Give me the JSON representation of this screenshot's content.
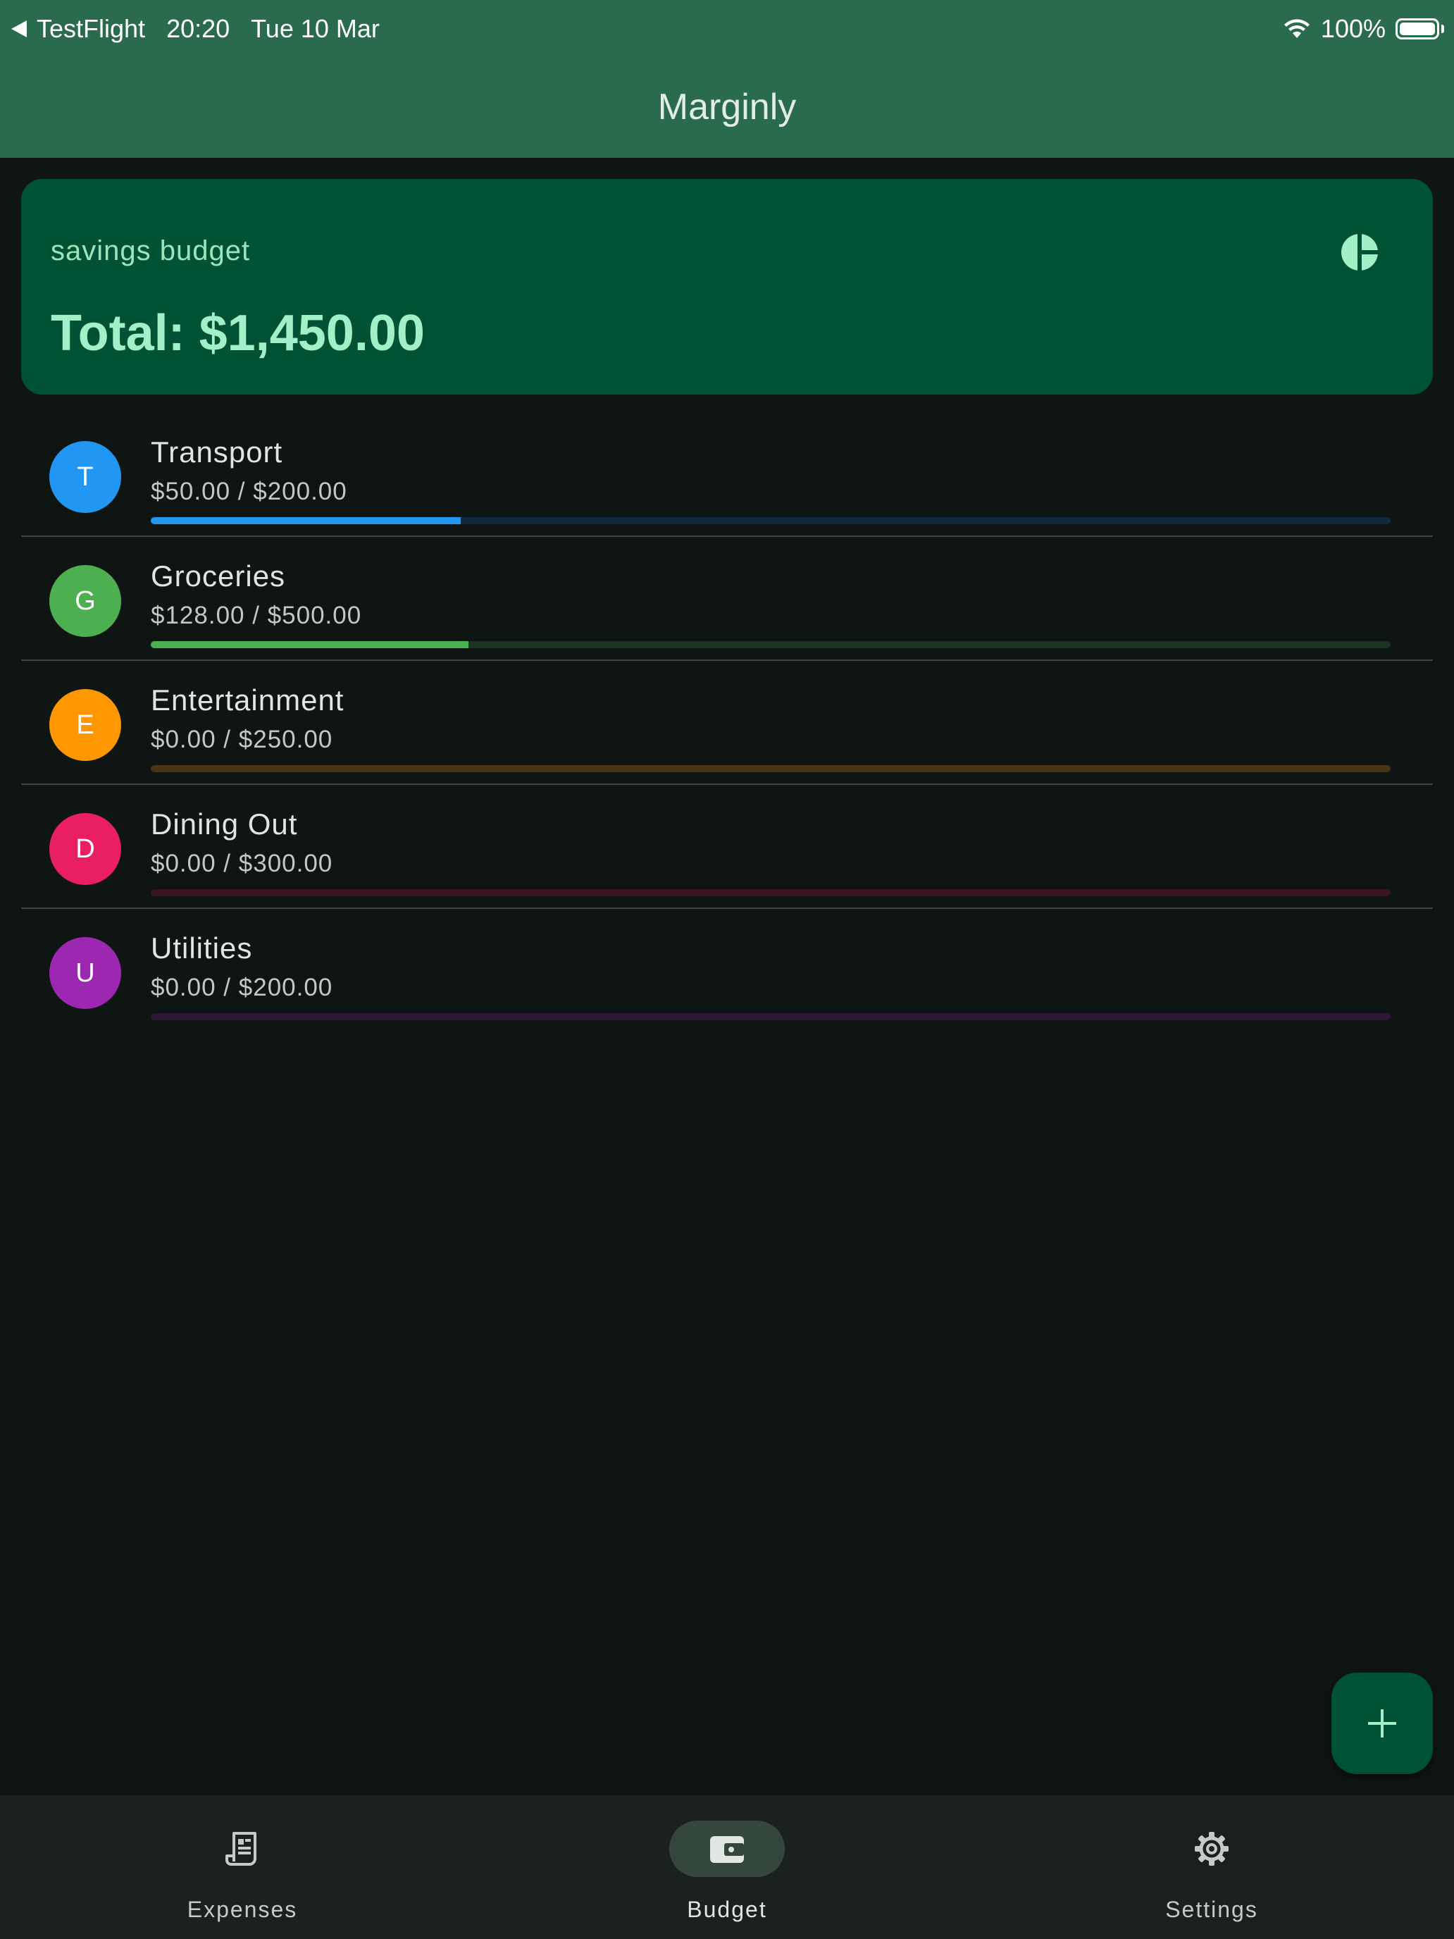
{
  "status_bar": {
    "back_app": "TestFlight",
    "time": "20:20",
    "date": "Tue 10 Mar",
    "battery": "100%"
  },
  "app_bar": {
    "title": "Marginly"
  },
  "summary": {
    "label": "savings budget",
    "total": "Total: $1,450.00",
    "icon": "pie-chart-icon"
  },
  "categories": [
    {
      "initial": "T",
      "name": "Transport",
      "amount": "$50.00 / $200.00",
      "progress": 0.25,
      "color": "#2196f3",
      "track_color": "#102a3b"
    },
    {
      "initial": "G",
      "name": "Groceries",
      "amount": "$128.00 / $500.00",
      "progress": 0.256,
      "color": "#4caf50",
      "track_color": "#1c3320"
    },
    {
      "initial": "E",
      "name": "Entertainment",
      "amount": "$0.00 / $250.00",
      "progress": 0,
      "color": "#ff9800",
      "track_color": "#4a3412"
    },
    {
      "initial": "D",
      "name": "Dining Out",
      "amount": "$0.00 / $300.00",
      "progress": 0,
      "color": "#e91e63",
      "track_color": "#3b1422"
    },
    {
      "initial": "U",
      "name": "Utilities",
      "amount": "$0.00 / $200.00",
      "progress": 0,
      "color": "#9c27b0",
      "track_color": "#2e1635"
    }
  ],
  "fab": {
    "icon": "plus-icon"
  },
  "bottom_nav": [
    {
      "label": "Expenses",
      "icon": "receipt-icon",
      "active": false
    },
    {
      "label": "Budget",
      "icon": "wallet-icon",
      "active": true
    },
    {
      "label": "Settings",
      "icon": "gear-icon",
      "active": false
    }
  ]
}
